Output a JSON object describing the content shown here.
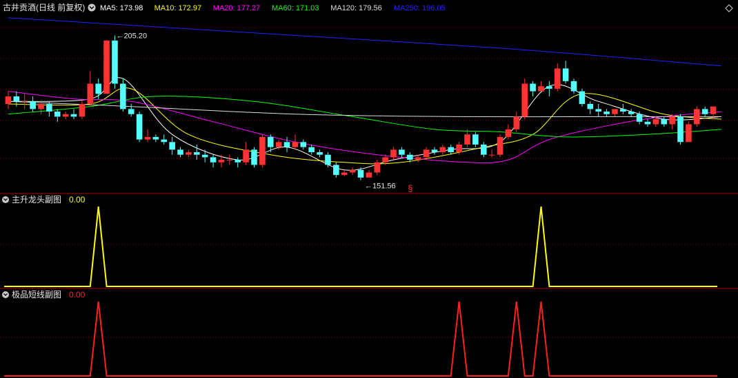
{
  "header": {
    "stock_title": "古井贡酒(日线 前复权)",
    "ma_readouts": [
      {
        "label": "MA5: 173.98",
        "color": "#ffffff"
      },
      {
        "label": "MA10: 172.97",
        "color": "#ffff00"
      },
      {
        "label": "MA20: 177.27",
        "color": "#ff00ff"
      },
      {
        "label": "MA60: 171.03",
        "color": "#00ff00"
      },
      {
        "label": "MA120: 179.56",
        "color": "#dddddd"
      },
      {
        "label": "MA250: 196.05",
        "color": "#2222ff"
      }
    ]
  },
  "panels": {
    "sub1": {
      "title": "主升龙头副图",
      "value": "0.00",
      "color": "#ffff00",
      "value_color": "#ffff00"
    },
    "sub2": {
      "title": "极品短线副图",
      "value": "0.00",
      "color": "#ff2020",
      "value_color": "#ff2020"
    }
  },
  "colors": {
    "up": "#ff3333",
    "down": "#54ffff",
    "grid": "#8a0000",
    "divider": "#b00000"
  },
  "chart_data": [
    {
      "type": "candlestick",
      "title": "古井贡酒(日线 前复权)",
      "ylim": [
        145,
        215
      ],
      "high_label": "205.20",
      "low_label": "151.56",
      "signal_marker": "§",
      "signal_candle_index": 49,
      "candles": [
        [
          180,
          183,
          178,
          185
        ],
        [
          183,
          181,
          179,
          185
        ],
        [
          181,
          181,
          178,
          184
        ],
        [
          181,
          178,
          177,
          183
        ],
        [
          178,
          180,
          176,
          181
        ],
        [
          180,
          177,
          175,
          181
        ],
        [
          177,
          175,
          173,
          178
        ],
        [
          175,
          176,
          174,
          177
        ],
        [
          176,
          175,
          174,
          178
        ],
        [
          175,
          180,
          174,
          182
        ],
        [
          180,
          188,
          179,
          193
        ],
        [
          188,
          184,
          182,
          190
        ],
        [
          184,
          205,
          184,
          205.2
        ],
        [
          205,
          188,
          186,
          207
        ],
        [
          188,
          178,
          177,
          190
        ],
        [
          178,
          176,
          175,
          180
        ],
        [
          176,
          166,
          165,
          177
        ],
        [
          166,
          167,
          165,
          170
        ],
        [
          167,
          166,
          165,
          168
        ],
        [
          166,
          165,
          164,
          168
        ],
        [
          165,
          162,
          160,
          167
        ],
        [
          162,
          160,
          159,
          163
        ],
        [
          160,
          161,
          159,
          162
        ],
        [
          161,
          160,
          158,
          164
        ],
        [
          160,
          159,
          157,
          162
        ],
        [
          159,
          157,
          155,
          160
        ],
        [
          157,
          158,
          155,
          160
        ],
        [
          158,
          158,
          156,
          160
        ],
        [
          158,
          157,
          155,
          159
        ],
        [
          157,
          162,
          156,
          165
        ],
        [
          162,
          156,
          155,
          163
        ],
        [
          156,
          167,
          155,
          168
        ],
        [
          167,
          163,
          161,
          168
        ],
        [
          163,
          165,
          162,
          166
        ],
        [
          165,
          163,
          161,
          167
        ],
        [
          163,
          165,
          162,
          168
        ],
        [
          165,
          163,
          162,
          166
        ],
        [
          163,
          161,
          160,
          164
        ],
        [
          161,
          160,
          159,
          162
        ],
        [
          160,
          156,
          155,
          161
        ],
        [
          156,
          152,
          151,
          157
        ],
        [
          152,
          153,
          151.56,
          154
        ],
        [
          153,
          154,
          152,
          155
        ],
        [
          154,
          151,
          150,
          155
        ],
        [
          151,
          153,
          151,
          154
        ],
        [
          153,
          157,
          152,
          158
        ],
        [
          157,
          159,
          156,
          160
        ],
        [
          159,
          162,
          158,
          163
        ],
        [
          162,
          160,
          159,
          163
        ],
        [
          160,
          158,
          157,
          161
        ],
        [
          158,
          159,
          157,
          160
        ],
        [
          159,
          162,
          158,
          163
        ],
        [
          162,
          161,
          160,
          163
        ],
        [
          161,
          163,
          160,
          164
        ],
        [
          163,
          161,
          160,
          164
        ],
        [
          161,
          164,
          160,
          165
        ],
        [
          164,
          168,
          163,
          170
        ],
        [
          168,
          164,
          163,
          169
        ],
        [
          164,
          160,
          159,
          165
        ],
        [
          160,
          160,
          159,
          162
        ],
        [
          160,
          167,
          159,
          168
        ],
        [
          167,
          170,
          166,
          172
        ],
        [
          170,
          175,
          169,
          177
        ],
        [
          175,
          188,
          174,
          190
        ],
        [
          188,
          185,
          183,
          189
        ],
        [
          185,
          187,
          185,
          189
        ],
        [
          187,
          186,
          183,
          189
        ],
        [
          186,
          194,
          185,
          196
        ],
        [
          194,
          189,
          188,
          197
        ],
        [
          189,
          185,
          184,
          190
        ],
        [
          185,
          180,
          179,
          186
        ],
        [
          180,
          178,
          176,
          181
        ],
        [
          178,
          177,
          175,
          180
        ],
        [
          177,
          176,
          175,
          178
        ],
        [
          176,
          178,
          175,
          178
        ],
        [
          178,
          177,
          176,
          180
        ],
        [
          177,
          176,
          175,
          178
        ],
        [
          176,
          173,
          172,
          177
        ],
        [
          173,
          172,
          171,
          174
        ],
        [
          172,
          174,
          171,
          175
        ],
        [
          174,
          172,
          171,
          175
        ],
        [
          172,
          175,
          170,
          176
        ],
        [
          175,
          165,
          164,
          176
        ],
        [
          165,
          172,
          165,
          173
        ],
        [
          172,
          178,
          171,
          179
        ],
        [
          178,
          176,
          175,
          179
        ],
        [
          176,
          179,
          174,
          179
        ]
      ],
      "moving_averages": [
        {
          "name": "MA5",
          "color": "#ffffff",
          "points": [
            [
              0,
              181
            ],
            [
              10,
              182
            ],
            [
              14,
              190
            ],
            [
              20,
              168
            ],
            [
              28,
              158
            ],
            [
              34,
              163
            ],
            [
              41,
              154
            ],
            [
              47,
              158
            ],
            [
              54,
              162
            ],
            [
              60,
              165
            ],
            [
              66,
              187
            ],
            [
              72,
              181
            ],
            [
              80,
              174
            ],
            [
              87,
              175
            ]
          ]
        },
        {
          "name": "MA10",
          "color": "#ffff00",
          "points": [
            [
              0,
              180
            ],
            [
              10,
              180
            ],
            [
              15,
              186
            ],
            [
              22,
              168
            ],
            [
              32,
              160
            ],
            [
              41,
              157
            ],
            [
              48,
              157
            ],
            [
              58,
              163
            ],
            [
              64,
              168
            ],
            [
              70,
              184
            ],
            [
              80,
              176
            ],
            [
              87,
              174
            ]
          ]
        },
        {
          "name": "MA20",
          "color": "#ff00ff",
          "points": [
            [
              0,
              185
            ],
            [
              8,
              182
            ],
            [
              15,
              181
            ],
            [
              25,
              173
            ],
            [
              35,
              165
            ],
            [
              45,
              160
            ],
            [
              56,
              157
            ],
            [
              61,
              158
            ],
            [
              66,
              166
            ],
            [
              74,
              172
            ],
            [
              80,
              175
            ],
            [
              87,
              177
            ]
          ]
        },
        {
          "name": "MA60",
          "color": "#00ff00",
          "points": [
            [
              0,
              176
            ],
            [
              10,
              179
            ],
            [
              18,
              183
            ],
            [
              30,
              181
            ],
            [
              42,
              175
            ],
            [
              52,
              170
            ],
            [
              60,
              169
            ],
            [
              68,
              167
            ],
            [
              78,
              168
            ],
            [
              87,
              170
            ]
          ]
        },
        {
          "name": "MA120",
          "color": "#dddddd",
          "points": [
            [
              0,
              181
            ],
            [
              15,
              179
            ],
            [
              35,
              176
            ],
            [
              55,
              175
            ],
            [
              75,
              175
            ],
            [
              87,
              175
            ]
          ]
        },
        {
          "name": "MA250",
          "color": "#2222ff",
          "points": [
            [
              0,
              214
            ],
            [
              30,
              208
            ],
            [
              60,
              202
            ],
            [
              87,
              195
            ]
          ]
        }
      ]
    },
    {
      "type": "line",
      "title": "主升龙头副图",
      "ylim": [
        0,
        1
      ],
      "series": [
        {
          "name": "主升龙头副图",
          "points": [
            [
              0,
              0
            ],
            [
              10,
              0
            ],
            [
              11,
              1
            ],
            [
              12,
              0
            ],
            [
              64,
              0
            ],
            [
              65,
              1
            ],
            [
              66,
              0
            ],
            [
              87,
              0
            ]
          ]
        }
      ]
    },
    {
      "type": "line",
      "title": "极品短线副图",
      "ylim": [
        0,
        1
      ],
      "series": [
        {
          "name": "极品短线副图",
          "points": [
            [
              0,
              0
            ],
            [
              10,
              0
            ],
            [
              11,
              1
            ],
            [
              12,
              0
            ],
            [
              54,
              0
            ],
            [
              55,
              1
            ],
            [
              56,
              0
            ],
            [
              61,
              0
            ],
            [
              62,
              1
            ],
            [
              63,
              0
            ],
            [
              64,
              0
            ],
            [
              65,
              1
            ],
            [
              66,
              0
            ],
            [
              87,
              0
            ]
          ]
        }
      ]
    }
  ]
}
